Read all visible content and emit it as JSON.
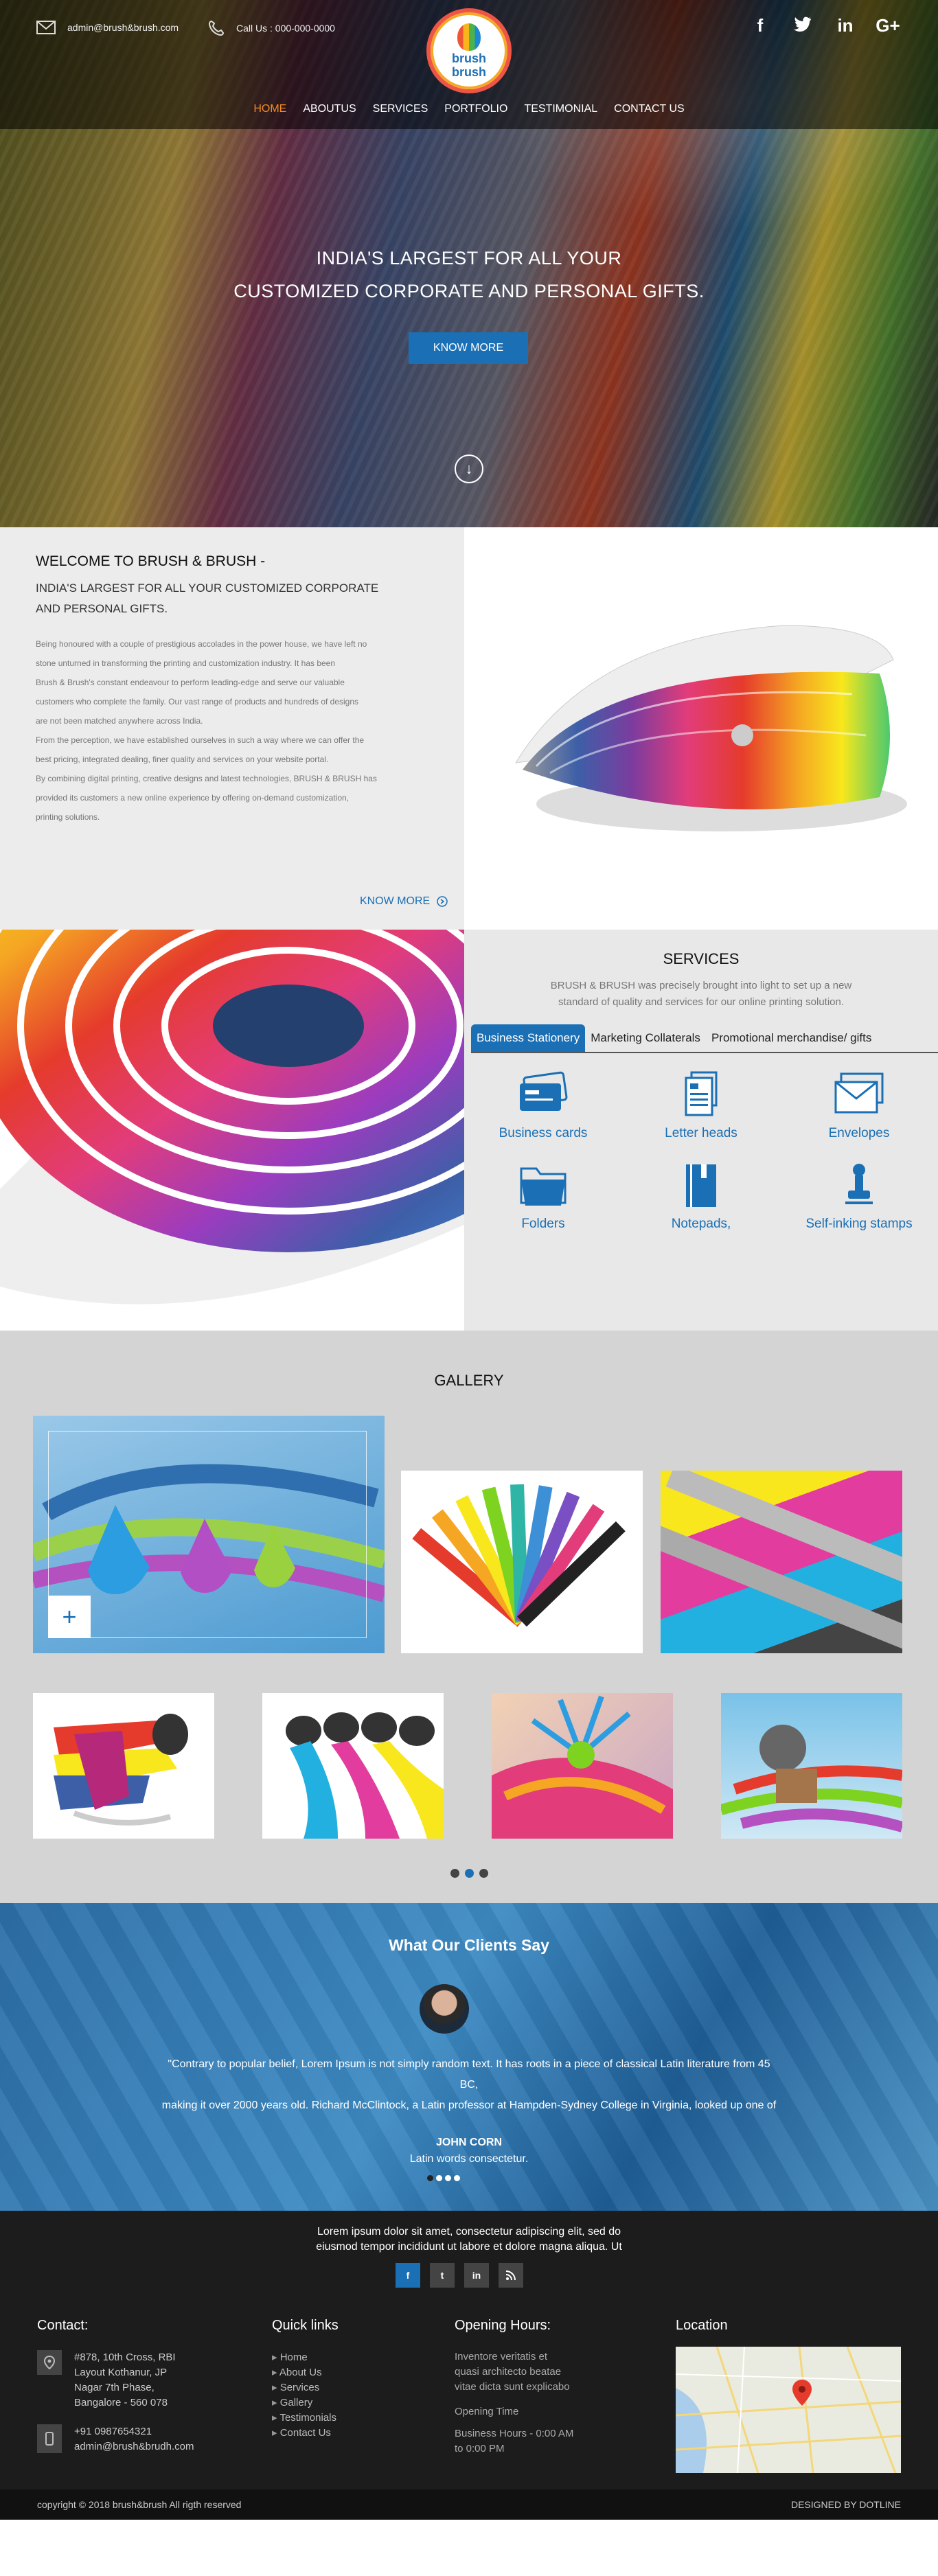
{
  "header": {
    "email": "admin@brush&brush.com",
    "phone": "Call Us : 000-000-0000",
    "logo_text_1": "brush",
    "logo_text_2": "brush",
    "social": [
      "f",
      "t",
      "in",
      "G+"
    ],
    "nav": [
      "HOME",
      "ABOUTUS",
      "SERVICES",
      "PORTFOLIO",
      "TESTIMONIAL",
      "CONTACT US"
    ]
  },
  "hero": {
    "line1": "INDIA'S LARGEST FOR ALL YOUR",
    "line2": "CUSTOMIZED CORPORATE AND PERSONAL GIFTS.",
    "button": "KNOW MORE",
    "down_icon": "arrow-down-circle-icon"
  },
  "welcome": {
    "title": "WELCOME TO BRUSH & BRUSH -",
    "subtitle_1": "INDIA'S LARGEST FOR ALL YOUR CUSTOMIZED CORPORATE",
    "subtitle_2": "AND PERSONAL GIFTS.",
    "paragraphs": [
      "Being honoured with a couple of prestigious accolades in the power house, we have left no",
      "stone unturned in transforming the printing and customization industry. It has been",
      "Brush & Brush's constant endeavour to perform leading-edge and serve our valuable",
      "customers who complete the family. Our vast range of products and hundreds of designs",
      "are not been matched anywhere across India.",
      "From the perception, we have established ourselves in such a way where we can offer the",
      "best pricing, integrated dealing, finer quality and services on your website portal.",
      "By combining digital printing, creative designs and latest technologies, BRUSH & BRUSH has",
      "provided its customers a new online experience by offering on-demand customization,",
      "printing solutions."
    ],
    "know_more": "KNOW MORE"
  },
  "services": {
    "title": "SERVICES",
    "description": "BRUSH & BRUSH was precisely brought into light to set up a new standard of quality and services for our online printing solution.",
    "tabs": [
      "Business Stationery",
      "Marketing Collaterals",
      "Promotional merchandise/ gifts"
    ],
    "items": [
      {
        "label": "Business cards",
        "icon": "business-card-icon"
      },
      {
        "label": "Letter heads",
        "icon": "letter-head-icon"
      },
      {
        "label": "Envelopes",
        "icon": "envelope-icon"
      },
      {
        "label": "Folders",
        "icon": "folder-icon"
      },
      {
        "label": "Notepads,",
        "icon": "notepad-icon"
      },
      {
        "label": "Self-inking stamps",
        "icon": "stamp-icon"
      }
    ]
  },
  "gallery": {
    "title": "GALLERY",
    "plus": "+"
  },
  "testimonials": {
    "title": "What Our Clients Say",
    "quote_1": "\"Contrary to popular belief, Lorem Ipsum is not simply random text. It has roots in a piece of classical Latin literature from 45",
    "quote_2": "BC,",
    "quote_3": "making it over 2000 years old. Richard McClintock, a Latin professor at Hampden-Sydney College in Virginia, looked up one of",
    "name": "JOHN CORN",
    "role": "Latin words consectetur."
  },
  "footer": {
    "intro_1": "Lorem ipsum dolor sit amet, consectetur adipiscing elit, sed do",
    "intro_2": "eiusmod tempor incididunt ut labore et dolore magna aliqua. Ut",
    "social": [
      "f",
      "t",
      "in",
      "rss"
    ],
    "contact_title": "Contact:",
    "address": [
      "#878, 10th Cross, RBI",
      "Layout Kothanur, JP",
      "Nagar 7th Phase,",
      "Bangalore - 560 078"
    ],
    "phone": "+91 0987654321",
    "email": "admin@brush&brudh.com",
    "quick_title": "Quick links",
    "quick_links": [
      "Home",
      "About Us",
      "Services",
      "Gallery",
      "Testimonials",
      "Contact Us"
    ],
    "hours_title": "Opening  Hours:",
    "hours_text": [
      "Inventore veritatis et",
      "quasi architecto beatae",
      "vitae dicta sunt explicabo"
    ],
    "opening_time_label": "Opening Time",
    "business_hours": [
      "Business Hours - 0:00 AM",
      "to 0:00 PM"
    ],
    "location_title": "Location",
    "copyright": "copyright ©  2018 brush&brush All rigth reserved",
    "designed_by": "DESIGNED BY DOTLINE"
  }
}
